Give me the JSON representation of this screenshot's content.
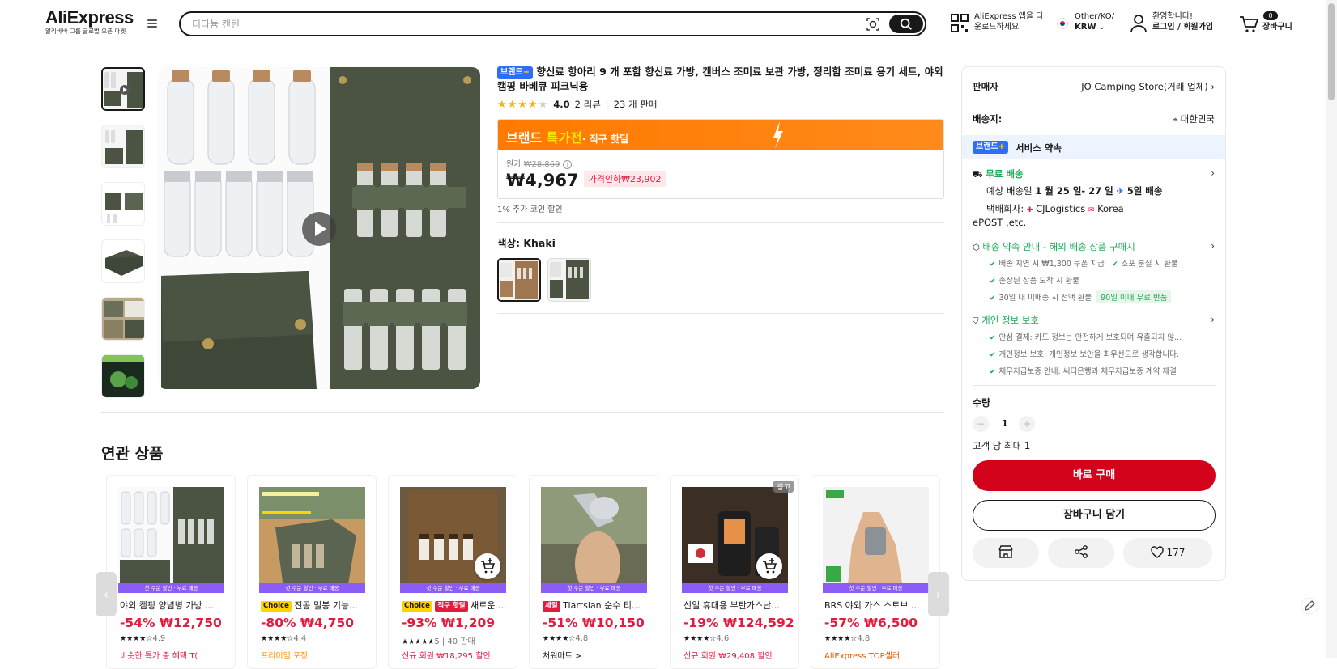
{
  "header": {
    "logo": "AliExpress",
    "logo_sub": "알리바바 그룹 글로벌 오픈 마켓",
    "search_placeholder": "티타늄 캔틴",
    "app_download_line1": "AliExpress 앱을 다",
    "app_download_line2": "운로드하세요",
    "region_line1": "Other/KO/",
    "region_line2": "KRW",
    "greeting": "환영합니다!",
    "login": "로그인 / 회원가입",
    "cart_count": "0",
    "cart_label": "장바구니"
  },
  "product": {
    "brand_badge": "브랜드",
    "title": "향신료 항아리 9 개 포함 향신료 가방, 캔버스 조미료 보관 가방, 정리함 조미료 용기 세트, 야외 캠핑 바베큐 피크닉용",
    "rating": "4.0",
    "stars": 4,
    "reviews": "2 리뷰",
    "sold": "23 개 판매",
    "deal_title_a": "브랜드 ",
    "deal_title_b": "특가전",
    "deal_sub": "· 직구 핫딜",
    "orig_label": "원가",
    "orig_price": "₩28,869",
    "price": "₩4,967",
    "price_drop": "가격인하₩23,902",
    "coin": "1% 추가 코인 할인",
    "color_label": "색상: Khaki"
  },
  "panel": {
    "seller_label": "판매자",
    "seller_value": "JO Camping Store(거래 업체)",
    "ship_to_label": "배송지:",
    "ship_to_value": "대한민국",
    "service_badge": "브랜드",
    "service_title": "서비스 약속",
    "free_ship": "무료 배송",
    "eta_a": "예상 배송일 ",
    "eta_b": "1 월 25 일- 27 일",
    "eta_c": "5일 배송",
    "courier_a": "택배회사:",
    "courier_b": "CJLogistics",
    "courier_c": "Korea",
    "courier_d": "ePOST ,etc.",
    "ship_promise": "배송 약속 안내 - 해외 배송 상품 구매시",
    "promise_1": "배송 지연 시 ₩1,300 쿠폰 지급",
    "promise_2": "소포 분실 시 환불",
    "promise_3": "손상된 상품 도착 시 환불",
    "promise_4": "30일 내 미배송 시 전액 환불",
    "promise_tag": "90일 이내 무료 반품",
    "privacy": "개인 정보 보호",
    "privacy_1": "안심 결제: 카드 정보는 안전하게 보호되며 유출되지 않...",
    "privacy_2": "개인정보 보호: 개인정보 보안을 최우선으로 생각합니다.",
    "privacy_3": "채무지급보증 안내: 씨티은행과 채무지급보증 계약 체결",
    "qty_label": "수량",
    "qty_value": "1",
    "qty_limit": "고객 당 최대 1",
    "buy_now": "바로 구매",
    "add_cart": "장바구니 담기",
    "wish_count": "177"
  },
  "related": {
    "title": "연관 상품",
    "strip": "첫 주문 할인 · 무료 배송",
    "items": [
      {
        "tag": "",
        "title": "야외 캠핑 양념병 가방 ...",
        "price": "-54% ₩12,750",
        "stars": "★★★★☆",
        "rate": "4.9",
        "extra": "비슷한 특가 중 혜택 T(",
        "extra_color": "#e51a3f"
      },
      {
        "tag": "Choice",
        "title": "진공 밀봉 기능...",
        "price": "-80% ₩4,750",
        "stars": "★★★★☆",
        "rate": "4.4",
        "extra": "프리미엄 포장",
        "extra_color": "#ff8c00"
      },
      {
        "tag": "Choice",
        "tag2": "직구 핫딜",
        "title": "새로운 ...",
        "price": "-93% ₩1,209",
        "stars": "★★★★★",
        "rate": "5 | 40 판매",
        "extra": "신규 회원 ₩18,295 할인",
        "extra_color": "#e51a3f"
      },
      {
        "tag": "세일",
        "title": "Tiartsian 순수 티...",
        "price": "-51% ₩10,150",
        "stars": "★★★★☆",
        "rate": "4.8",
        "extra": "처워마트 >",
        "extra_color": "#191919"
      },
      {
        "tag": "",
        "title": "신일 휴대용 부탄가스난...",
        "price": "-19% ₩124,592",
        "stars": "★★★★☆",
        "rate": "4.6",
        "extra": "신규 회원 ₩29,408 할인",
        "extra_color": "#e51a3f",
        "ad": "광고"
      },
      {
        "tag": "",
        "title": "BRS 야외 가스 스토브 ...",
        "price": "-57% ₩6,500",
        "stars": "★★★★☆",
        "rate": "4.8",
        "extra": "AliExpress TOP셀러",
        "extra_color": "#e05a00"
      }
    ]
  }
}
